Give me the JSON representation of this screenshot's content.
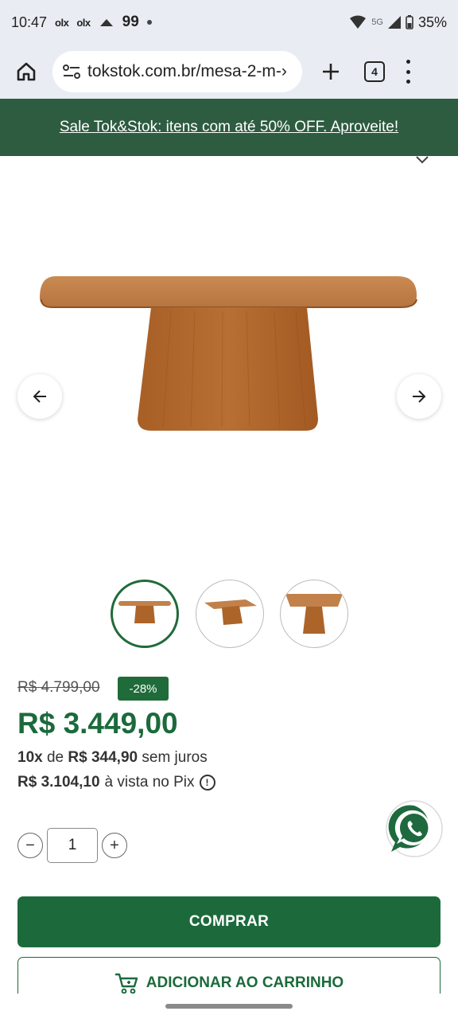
{
  "status_bar": {
    "time": "10:47",
    "app_icon_1": "olx",
    "app_icon_2": "olx",
    "notification_count": "99",
    "network": "5G",
    "battery": "35%"
  },
  "browser": {
    "url": "tokstok.com.br/mesa-2-m-›",
    "tab_count": "4"
  },
  "promo": {
    "text": "Sale Tok&Stok: itens com até 50% OFF. Aproveite!"
  },
  "product": {
    "old_price": "R$ 4.799,00",
    "discount": "-28%",
    "price": "R$ 3.449,00",
    "installment_count": "10x",
    "installment_of": "de",
    "installment_value": "R$ 344,90",
    "installment_suffix": "sem juros",
    "pix_price": "R$ 3.104,10",
    "pix_suffix": "à vista no Pix",
    "quantity": "1",
    "qty_minus": "−",
    "qty_plus": "+"
  },
  "actions": {
    "buy_label": "COMPRAR",
    "cart_label": "ADICIONAR AO CARRINHO"
  },
  "colors": {
    "brand_green": "#1c6a3c",
    "promo_bg": "#2e5c40",
    "wood": "#b06a32"
  },
  "icons": {
    "home": "home-icon",
    "site_settings": "tune-icon",
    "prev": "arrow-left-icon",
    "next": "arrow-right-icon",
    "whatsapp": "whatsapp-icon",
    "cart": "cart-icon",
    "info": "info-icon"
  }
}
